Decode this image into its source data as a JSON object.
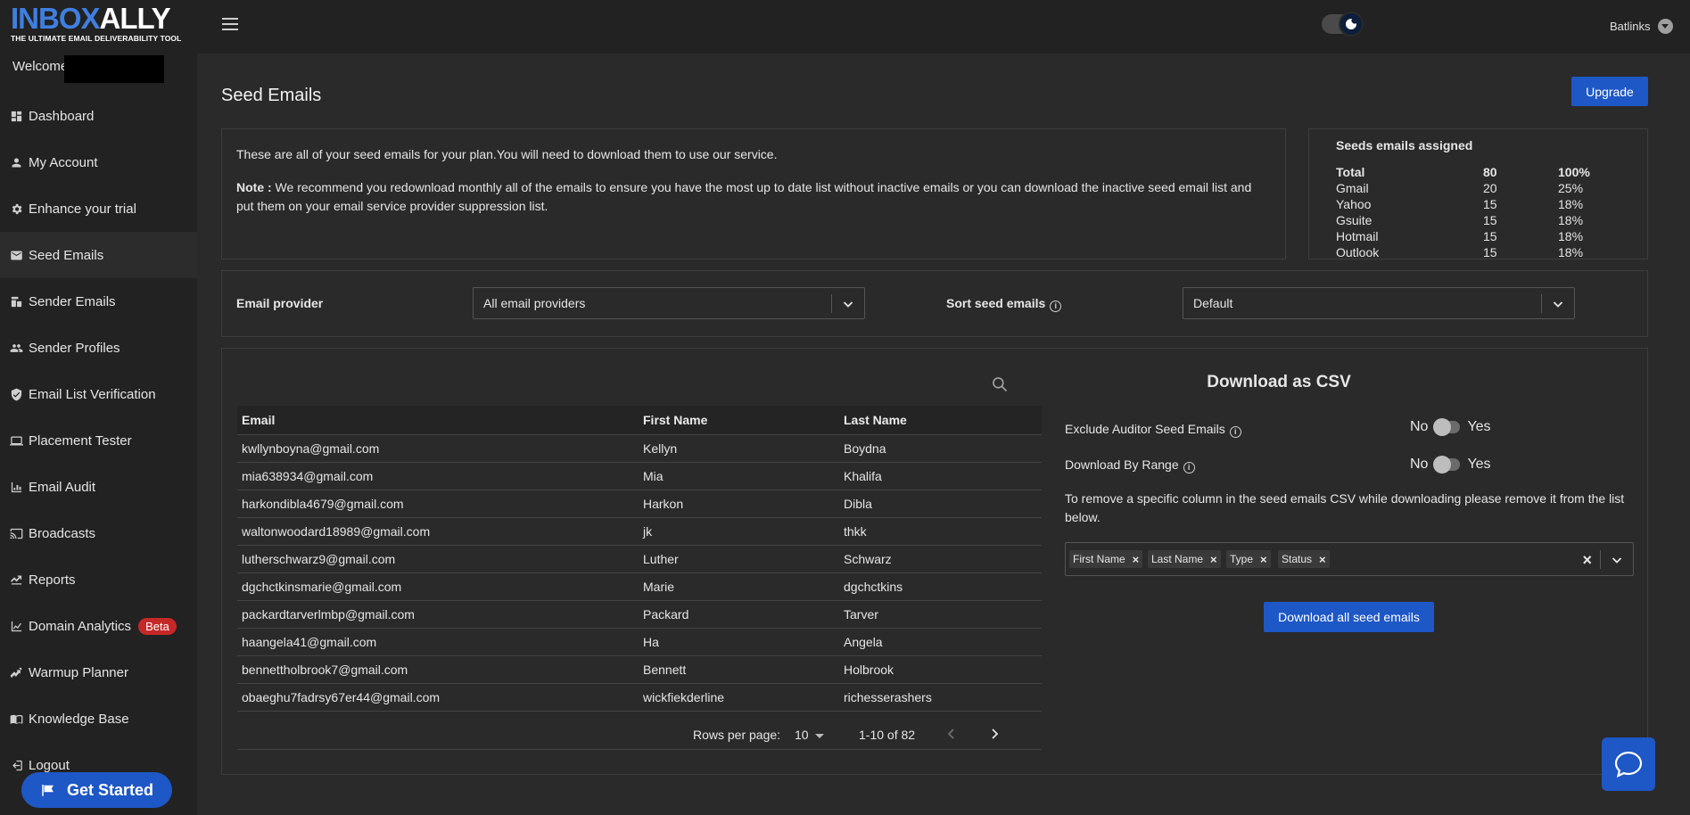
{
  "brand": {
    "name_part1": "INBOX",
    "name_part2": "ALLY",
    "tagline": "THE ULTIMATE EMAIL DELIVERABILITY TOOL"
  },
  "sidebar": {
    "welcome": "Welcome",
    "items": [
      {
        "label": "Dashboard",
        "icon": "dashboard-icon"
      },
      {
        "label": "My Account",
        "icon": "person-icon"
      },
      {
        "label": "Enhance your trial",
        "icon": "gear-icon"
      },
      {
        "label": "Seed Emails",
        "icon": "mail-icon",
        "active": true
      },
      {
        "label": "Sender Emails",
        "icon": "sender-icon"
      },
      {
        "label": "Sender Profiles",
        "icon": "people-icon"
      },
      {
        "label": "Email List Verification",
        "icon": "shield-icon"
      },
      {
        "label": "Placement Tester",
        "icon": "laptop-icon"
      },
      {
        "label": "Email Audit",
        "icon": "chart-icon"
      },
      {
        "label": "Broadcasts",
        "icon": "cast-icon"
      },
      {
        "label": "Reports",
        "icon": "report-icon"
      },
      {
        "label": "Domain Analytics",
        "icon": "analytics-icon",
        "badge": "Beta"
      },
      {
        "label": "Warmup Planner",
        "icon": "warmup-icon"
      },
      {
        "label": "Knowledge Base",
        "icon": "book-icon"
      },
      {
        "label": "Logout",
        "icon": "logout-icon"
      }
    ],
    "get_started": "Get Started"
  },
  "topbar": {
    "user": "Batlinks"
  },
  "page": {
    "title": "Seed Emails",
    "upgrade": "Upgrade"
  },
  "info": {
    "line1": "These are all of your seed emails for your plan.You will need to download them to use our service.",
    "note_label": "Note :",
    "note_text": " We recommend you redownload monthly all of the emails to ensure you have the most up to date list without inactive emails or you can download the inactive seed email list and put them on your email service provider suppression list."
  },
  "stats": {
    "title": "Seeds emails assigned",
    "rows": [
      {
        "name": "Total",
        "count": "80",
        "pct": "100%"
      },
      {
        "name": "Gmail",
        "count": "20",
        "pct": "25%"
      },
      {
        "name": "Yahoo",
        "count": "15",
        "pct": "18%"
      },
      {
        "name": "Gsuite",
        "count": "15",
        "pct": "18%"
      },
      {
        "name": "Hotmail",
        "count": "15",
        "pct": "18%"
      },
      {
        "name": "Outlook",
        "count": "15",
        "pct": "18%"
      }
    ]
  },
  "filters": {
    "provider_label": "Email provider",
    "provider_value": "All email providers",
    "sort_label": "Sort seed emails",
    "sort_value": "Default"
  },
  "table": {
    "headers": [
      "Email",
      "First Name",
      "Last Name"
    ],
    "rows": [
      [
        "kwllynboyna@gmail.com",
        "Kellyn",
        "Boydna"
      ],
      [
        "mia638934@gmail.com",
        "Mia",
        "Khalifa"
      ],
      [
        "harkondibla4679@gmail.com",
        "Harkon",
        "Dibla"
      ],
      [
        "waltonwoodard18989@gmail.com",
        "jk",
        "thkk"
      ],
      [
        "lutherschwarz9@gmail.com",
        "Luther",
        "Schwarz"
      ],
      [
        "dgchctkinsmarie@gmail.com",
        "Marie",
        "dgchctkins"
      ],
      [
        "packardtarverlmbp@gmail.com",
        "Packard",
        "Tarver"
      ],
      [
        "haangela41@gmail.com",
        "Ha",
        "Angela"
      ],
      [
        "bennettholbrook7@gmail.com",
        "Bennett",
        "Holbrook"
      ],
      [
        "obaeghu7fadrsy67er44@gmail.com",
        "wickfiekderline",
        "richesserashers"
      ]
    ],
    "rows_per_page_label": "Rows per page:",
    "rows_per_page": "10",
    "range": "1-10 of 82"
  },
  "download": {
    "title": "Download as CSV",
    "exclude_label": "Exclude Auditor Seed Emails",
    "range_label": "Download By Range",
    "no": "No",
    "yes": "Yes",
    "remove_text": "To remove a specific column in the seed emails CSV while downloading please remove it from the list below.",
    "chips": [
      "First Name",
      "Last Name",
      "Type",
      "Status"
    ],
    "button": "Download all seed emails"
  }
}
